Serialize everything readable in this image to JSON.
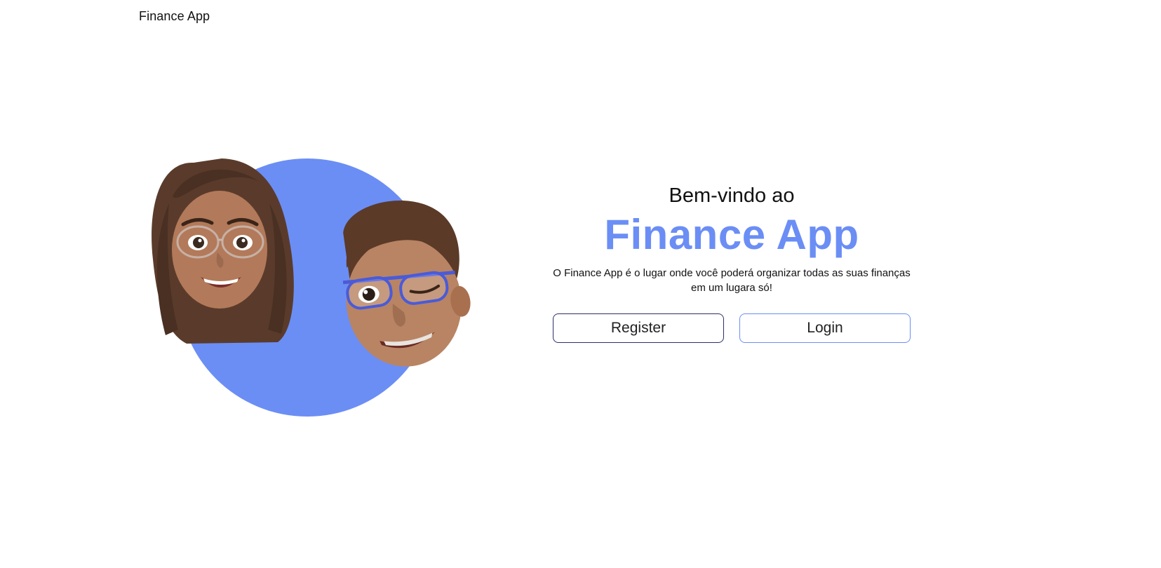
{
  "header": {
    "brand": "Finance App"
  },
  "hero": {
    "illustration_icon": "memoji-couple-illustration",
    "accent_color": "#6b8ef5"
  },
  "welcome": {
    "kicker": "Bem-vindo ao",
    "title": "Finance App",
    "description": "O Finance App é o lugar onde você poderá organizar todas as suas finanças em um lugara só!"
  },
  "actions": {
    "register_label": "Register",
    "login_label": "Login"
  }
}
